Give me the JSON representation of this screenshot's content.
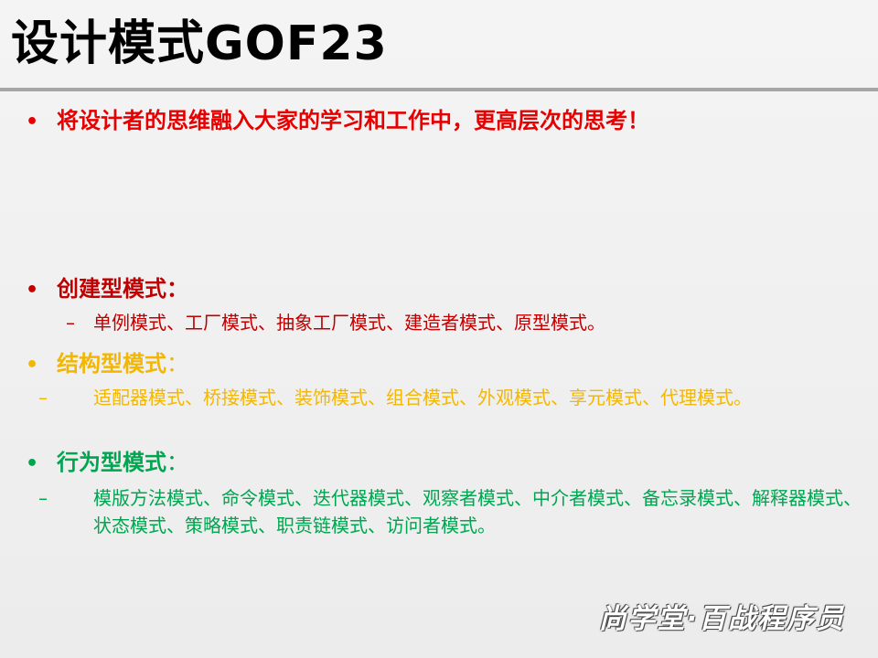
{
  "slide": {
    "title": "设计模式GOF23",
    "bullets": [
      {
        "dot": "•",
        "text": "将设计者的思维融入大家的学习和工作中，更高层次的思考！",
        "color": "#e60000"
      },
      {
        "dot": "•",
        "text": "创建型模式：",
        "color": "#c00000"
      },
      {
        "dot": "•",
        "text": "结构型模式",
        "suffix": "：",
        "color": "#f2b705"
      },
      {
        "dot": "•",
        "text": "行为型模式",
        "suffix": "：",
        "color": "#00a550"
      }
    ],
    "subs": [
      {
        "dash": "–",
        "text": "单例模式、工厂模式、抽象工厂模式、建造者模式、原型模式。",
        "color": "#c00000"
      },
      {
        "dash": "–",
        "text": "适配器模式、桥接模式、装饰模式、组合模式、外观模式、享元模式、代理模式。",
        "color": "#f2b705"
      },
      {
        "dash": "–",
        "text": "模版方法模式、命令模式、迭代器模式、观察者模式、中介者模式、备忘录模式、解释器模式、状态模式、策略模式、职责链模式、访问者模式。",
        "color": "#00a550"
      }
    ],
    "watermark": "尚学堂·百战程序员"
  }
}
